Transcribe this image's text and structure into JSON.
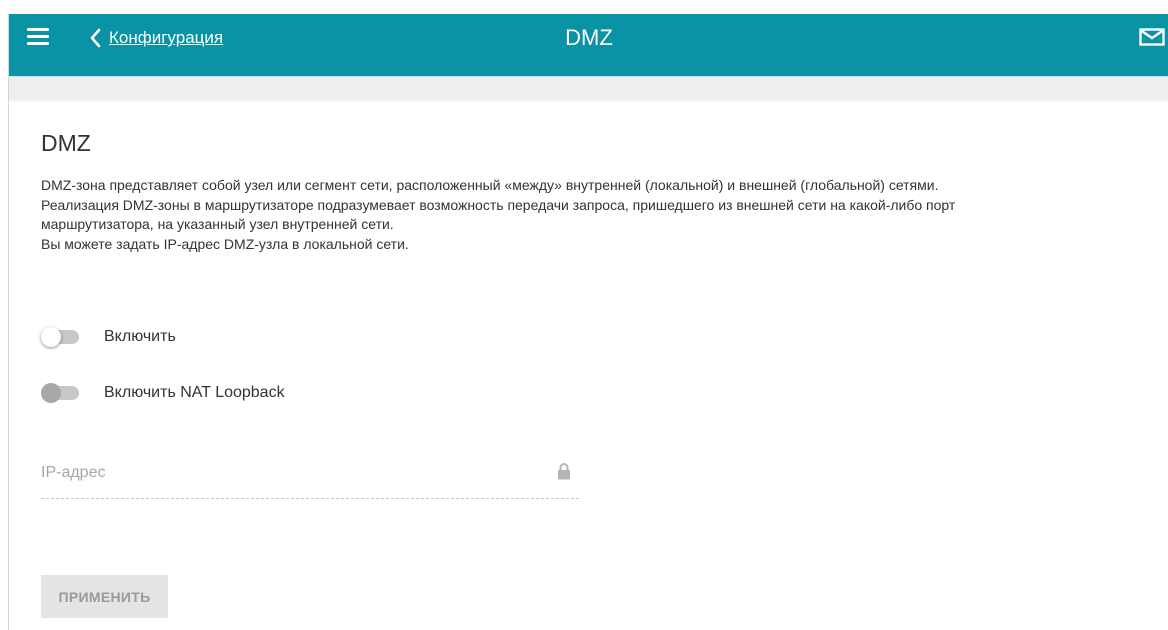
{
  "header": {
    "back_label": "Конфигурация",
    "title": "DMZ",
    "icons": {
      "menu": "hamburger-icon",
      "back": "chevron-left-icon",
      "notifications": "mail-icon"
    },
    "bg_color": "#0a93a5"
  },
  "section": {
    "title": "DMZ",
    "description_lines": [
      "DMZ-зона представляет собой узел или сегмент сети, расположенный «между» внутренней (локальной) и внешней (глобальной) сетями.",
      "Реализация DMZ-зоны в маршрутизаторе подразумевает возможность передачи запроса, пришедшего из внешней сети на какой-либо порт",
      "маршрутизатора, на указанный узел внутренней сети.",
      "Вы можете задать IP-адрес DMZ-узла в локальной сети."
    ]
  },
  "toggles": {
    "enable": {
      "label": "Включить",
      "state": "off"
    },
    "nat_loopback": {
      "label": "Включить NAT Loopback",
      "state": "off-disabled"
    }
  },
  "ip_field": {
    "placeholder": "IP-адрес",
    "value": "",
    "icon": "lock-icon"
  },
  "apply_button": {
    "label": "ПРИМЕНИТЬ",
    "state": "disabled"
  }
}
